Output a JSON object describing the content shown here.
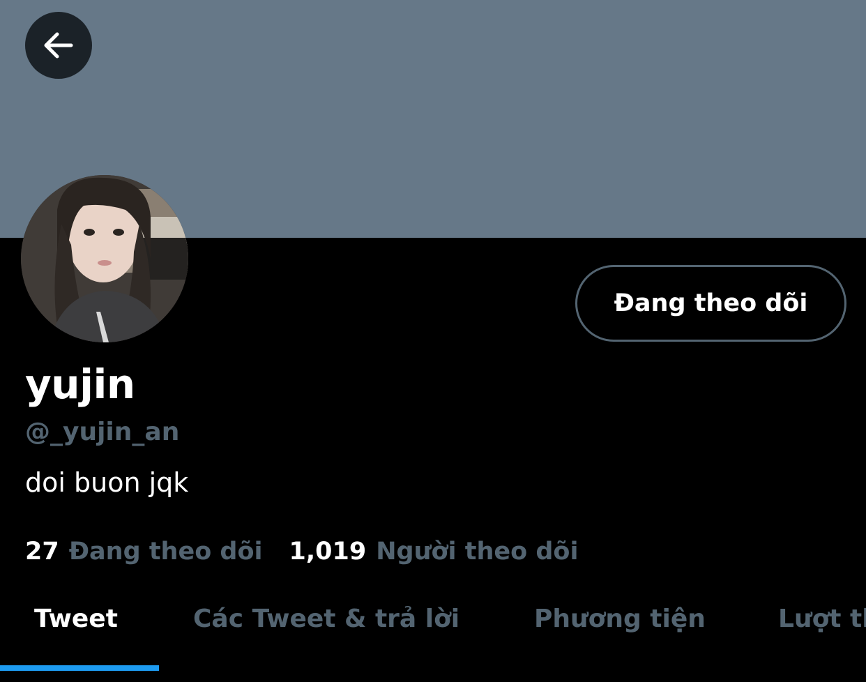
{
  "header": {
    "back_icon": "arrow-left-icon",
    "banner_color": "#667888"
  },
  "profile": {
    "display_name": "yujin",
    "handle": "@_yujin_an",
    "bio": "doi buon jqk",
    "follow_button_label": "Đang theo dõi"
  },
  "stats": {
    "following_count": "27",
    "following_label": "Đang theo dõi",
    "followers_count": "1,019",
    "followers_label": "Người theo dõi"
  },
  "tabs": [
    {
      "label": "Tweet",
      "active": true
    },
    {
      "label": "Các Tweet & trả lời",
      "active": false
    },
    {
      "label": "Phương tiện",
      "active": false
    },
    {
      "label": "Lượt thích",
      "active": false
    }
  ],
  "colors": {
    "accent": "#1d9bf0",
    "muted_text": "#536471",
    "background": "#000000"
  }
}
